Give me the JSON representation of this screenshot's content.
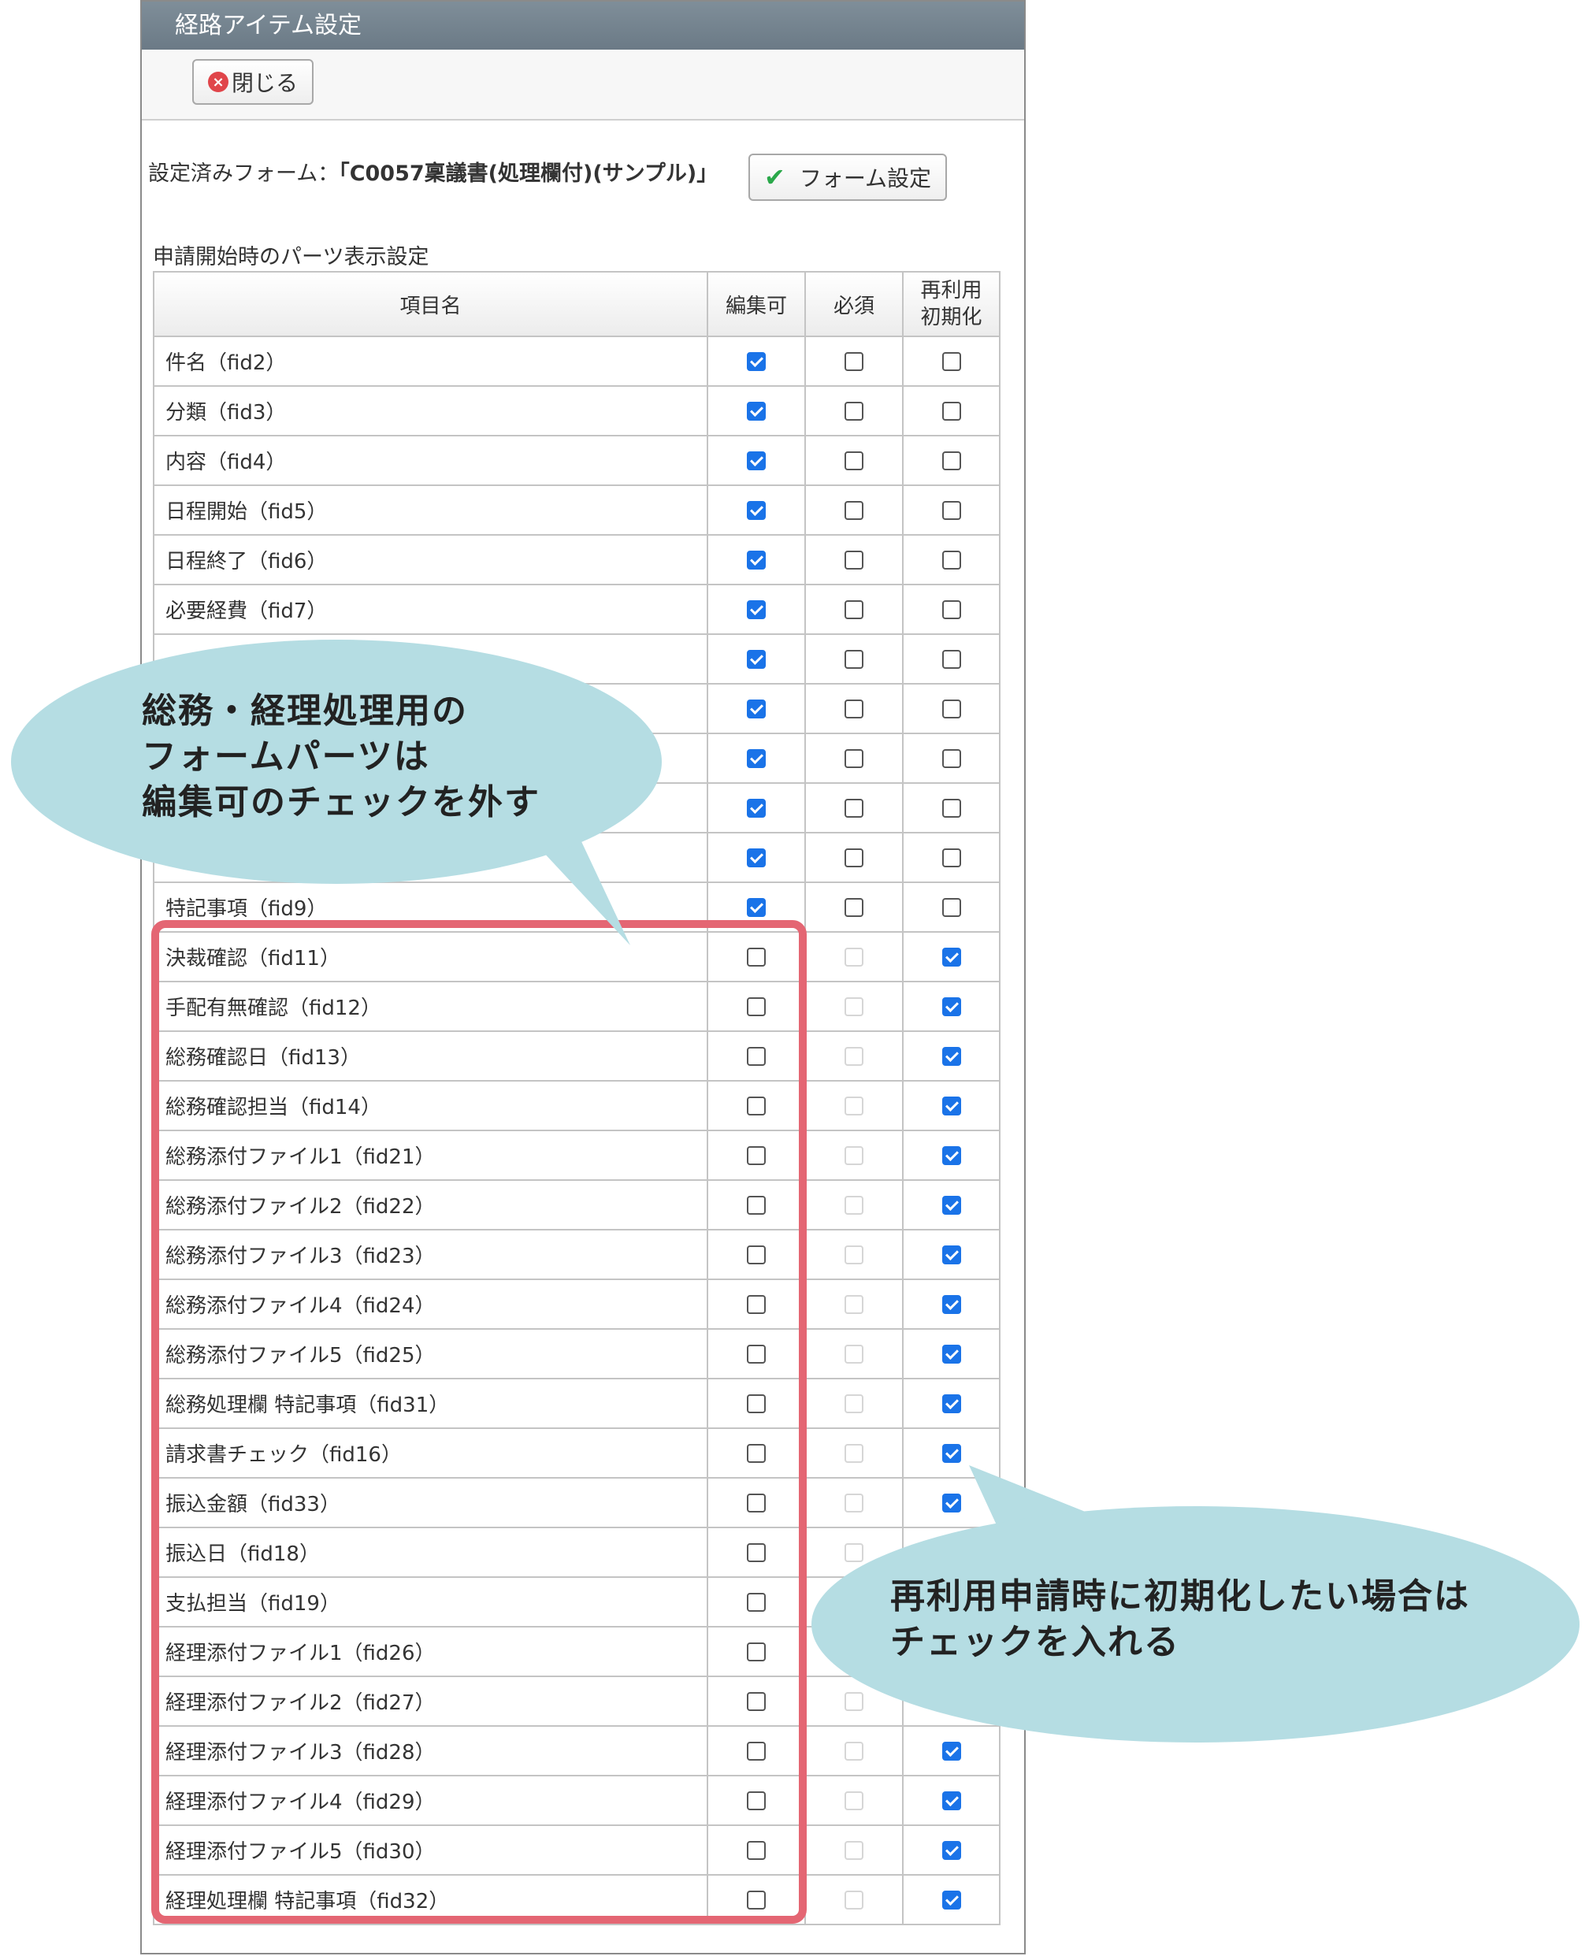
{
  "window": {
    "title": "経路アイテム設定"
  },
  "toolbar": {
    "close_label": "閉じる",
    "close_icon": "×"
  },
  "form": {
    "prefix": "設定済みフォーム：",
    "name": "「C0057稟議書(処理欄付)(サンプル)」",
    "button_label": "フォーム設定",
    "button_icon": "✔"
  },
  "section": {
    "label": "申請開始時のパーツ表示設定"
  },
  "table": {
    "headers": {
      "name": "項目名",
      "editable": "編集可",
      "required": "必須",
      "reset_line1": "再利用",
      "reset_line2": "初期化"
    },
    "rows": [
      {
        "name": "件名（fid2）",
        "editable": true,
        "required": false,
        "required_disabled": false,
        "reset": false
      },
      {
        "name": "分類（fid3）",
        "editable": true,
        "required": false,
        "required_disabled": false,
        "reset": false
      },
      {
        "name": "内容（fid4）",
        "editable": true,
        "required": false,
        "required_disabled": false,
        "reset": false
      },
      {
        "name": "日程開始（fid5）",
        "editable": true,
        "required": false,
        "required_disabled": false,
        "reset": false
      },
      {
        "name": "日程終了（fid6）",
        "editable": true,
        "required": false,
        "required_disabled": false,
        "reset": false
      },
      {
        "name": "必要経費（fid7）",
        "editable": true,
        "required": false,
        "required_disabled": false,
        "reset": false
      },
      {
        "name": "",
        "editable": true,
        "required": false,
        "required_disabled": false,
        "reset": false
      },
      {
        "name": "",
        "editable": true,
        "required": false,
        "required_disabled": false,
        "reset": false
      },
      {
        "name": "",
        "editable": true,
        "required": false,
        "required_disabled": false,
        "reset": false
      },
      {
        "name": "",
        "editable": true,
        "required": false,
        "required_disabled": false,
        "reset": false
      },
      {
        "name": "",
        "editable": true,
        "required": false,
        "required_disabled": false,
        "reset": false
      },
      {
        "name": "特記事項（fid9）",
        "editable": true,
        "required": false,
        "required_disabled": false,
        "reset": false
      },
      {
        "name": "決裁確認（fid11）",
        "editable": false,
        "required": false,
        "required_disabled": true,
        "reset": true
      },
      {
        "name": "手配有無確認（fid12）",
        "editable": false,
        "required": false,
        "required_disabled": true,
        "reset": true
      },
      {
        "name": "総務確認日（fid13）",
        "editable": false,
        "required": false,
        "required_disabled": true,
        "reset": true
      },
      {
        "name": "総務確認担当（fid14）",
        "editable": false,
        "required": false,
        "required_disabled": true,
        "reset": true
      },
      {
        "name": "総務添付ファイル1（fid21）",
        "editable": false,
        "required": false,
        "required_disabled": true,
        "reset": true
      },
      {
        "name": "総務添付ファイル2（fid22）",
        "editable": false,
        "required": false,
        "required_disabled": true,
        "reset": true
      },
      {
        "name": "総務添付ファイル3（fid23）",
        "editable": false,
        "required": false,
        "required_disabled": true,
        "reset": true
      },
      {
        "name": "総務添付ファイル4（fid24）",
        "editable": false,
        "required": false,
        "required_disabled": true,
        "reset": true
      },
      {
        "name": "総務添付ファイル5（fid25）",
        "editable": false,
        "required": false,
        "required_disabled": true,
        "reset": true
      },
      {
        "name": "総務処理欄 特記事項（fid31）",
        "editable": false,
        "required": false,
        "required_disabled": true,
        "reset": true
      },
      {
        "name": "請求書チェック（fid16）",
        "editable": false,
        "required": false,
        "required_disabled": true,
        "reset": true
      },
      {
        "name": "振込金額（fid33）",
        "editable": false,
        "required": false,
        "required_disabled": true,
        "reset": true
      },
      {
        "name": "振込日（fid18）",
        "editable": false,
        "required": false,
        "required_disabled": true,
        "reset": true
      },
      {
        "name": "支払担当（fid19）",
        "editable": false,
        "required": false,
        "required_disabled": true,
        "reset": true
      },
      {
        "name": "経理添付ファイル1（fid26）",
        "editable": false,
        "required": false,
        "required_disabled": true,
        "reset": true
      },
      {
        "name": "経理添付ファイル2（fid27）",
        "editable": false,
        "required": false,
        "required_disabled": true,
        "reset": true
      },
      {
        "name": "経理添付ファイル3（fid28）",
        "editable": false,
        "required": false,
        "required_disabled": true,
        "reset": true
      },
      {
        "name": "経理添付ファイル4（fid29）",
        "editable": false,
        "required": false,
        "required_disabled": true,
        "reset": true
      },
      {
        "name": "経理添付ファイル5（fid30）",
        "editable": false,
        "required": false,
        "required_disabled": true,
        "reset": true
      },
      {
        "name": "経理処理欄 特記事項（fid32）",
        "editable": false,
        "required": false,
        "required_disabled": true,
        "reset": true
      }
    ]
  },
  "callouts": {
    "left": {
      "line1": "総務・経理処理用の",
      "line2": "フォームパーツは",
      "line3": "編集可のチェックを外す"
    },
    "right": {
      "line1": "再利用申請時に初期化したい場合は",
      "line2": "チェックを入れる"
    }
  },
  "colors": {
    "titlebar": "#6b7a86",
    "checked": "#1a73e8",
    "highlight": "#e46673",
    "callout": "#b5dde3"
  }
}
